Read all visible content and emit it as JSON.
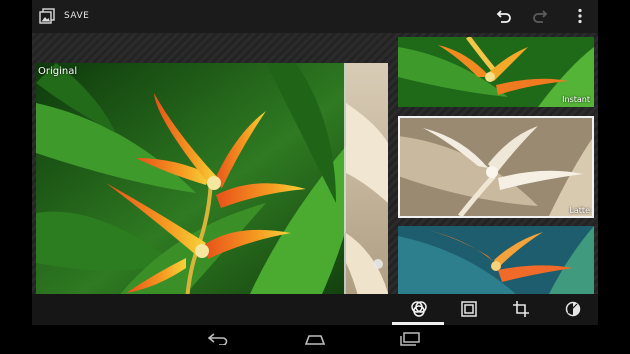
{
  "topbar": {
    "save_label": "SAVE",
    "save_icon": "photo-save-icon",
    "undo_icon": "undo-icon",
    "redo_icon": "redo-icon",
    "more_icon": "overflow-menu-icon"
  },
  "preview": {
    "label": "Original"
  },
  "filters": [
    {
      "label": "Instant",
      "selected": false
    },
    {
      "label": "Latte",
      "selected": true
    },
    {
      "label": "",
      "selected": false
    }
  ],
  "tools": [
    {
      "icon": "filters-icon",
      "active": true
    },
    {
      "icon": "border-icon",
      "active": false
    },
    {
      "icon": "crop-icon",
      "active": false
    },
    {
      "icon": "adjust-icon",
      "active": false
    }
  ],
  "navbar": {
    "back_icon": "back-icon",
    "home_icon": "home-icon",
    "recents_icon": "recents-icon"
  },
  "colors": {
    "accent": "#f0f0f0",
    "actionbar": "#1b1b1b",
    "background": "#000000"
  }
}
